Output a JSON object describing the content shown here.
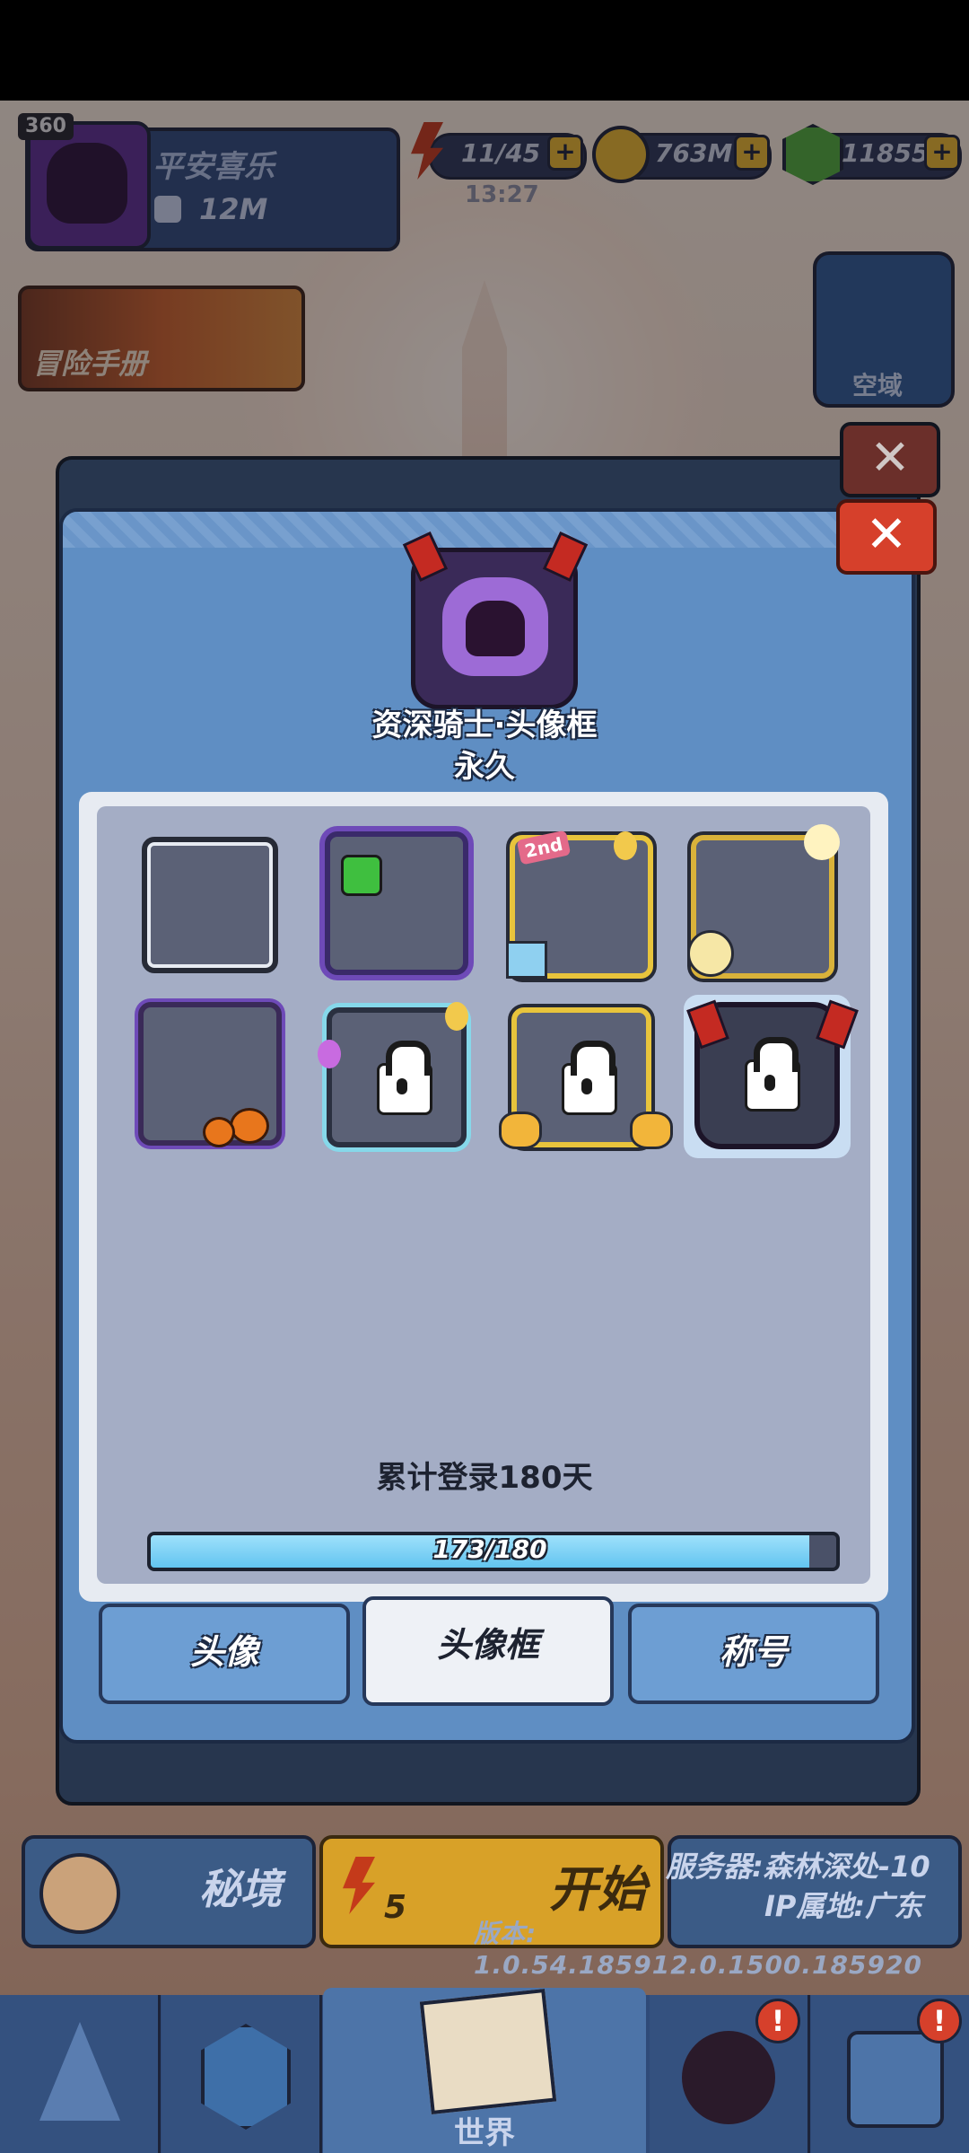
{
  "player": {
    "level": "360",
    "name": "平安喜乐",
    "power": "12M"
  },
  "resources": {
    "energy": "11/45",
    "energy_timer": "13:27",
    "gold": "763M",
    "gems": "11855"
  },
  "adventure_banner": "冒险手册",
  "kongyu": "空域",
  "modal": {
    "frame_name": "资深骑士·头像框",
    "duration": "永久",
    "login_requirement": "累计登录180天",
    "progress": {
      "text": "173/180",
      "fraction": 0.961
    },
    "tabs": [
      {
        "label": "头像",
        "active": false
      },
      {
        "label": "头像框",
        "active": true
      },
      {
        "label": "称号",
        "active": false
      }
    ],
    "frames": [
      {
        "id": "default",
        "locked": false
      },
      {
        "id": "purple-monster",
        "locked": false
      },
      {
        "id": "anniversary-2nd",
        "locked": false,
        "badge": "2nd"
      },
      {
        "id": "moon-tree",
        "locked": false
      },
      {
        "id": "halloween",
        "locked": false
      },
      {
        "id": "balloon",
        "locked": true
      },
      {
        "id": "thumbs-up",
        "locked": true
      },
      {
        "id": "senior-knight",
        "locked": true,
        "selected": true
      }
    ]
  },
  "bottom": {
    "secret_realm": "秘境",
    "start": "开始",
    "start_count": "5",
    "server": "服务器:森林深处-10",
    "ip_location": "IP属地:广东",
    "version": "版本: 1.0.54.185912.0.1500.185920"
  },
  "nav": {
    "center_label": "世界",
    "alert_mark": "!"
  },
  "colors": {
    "accent_red": "#d6402b",
    "modal_blue": "#5f8ec3",
    "progress_fill": "#62c4f0"
  }
}
